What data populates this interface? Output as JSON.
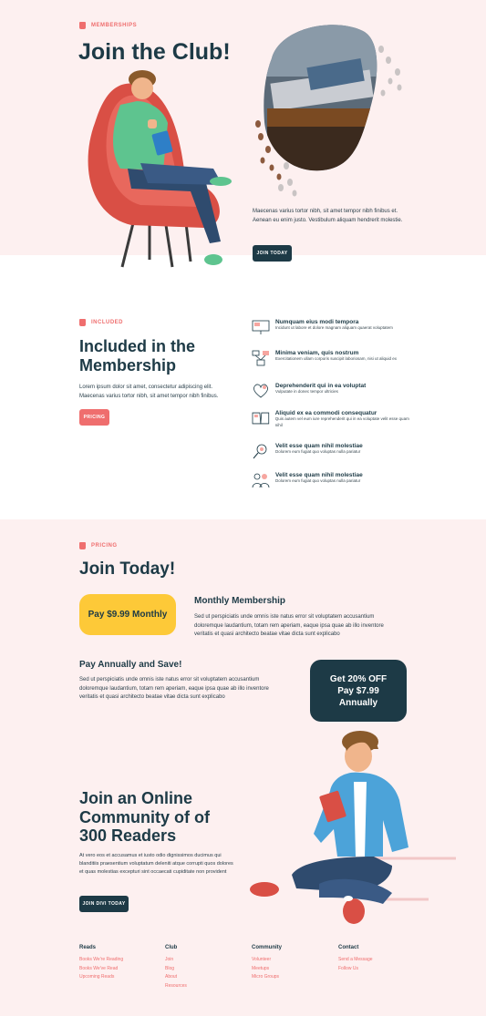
{
  "hero": {
    "eyebrow": "MEMBERSHIPS",
    "title": "Join the Club!",
    "description": "Maecenas varius tortor nibh, sit amet tempor nibh finibus et. Aenean eu enim justo. Vestibulum aliquam hendrerit molestie.",
    "cta": "JOIN TODAY"
  },
  "included": {
    "eyebrow": "INCLUDED",
    "title_line1": "Included in the",
    "title_line2": "Membership",
    "description": "Lorem ipsum dolor sit amet, consectetur adipiscing elit. Maecenas varius tortor nibh, sit amet tempor nibh finibus.",
    "cta": "PRICING",
    "features": [
      {
        "icon": "presentation-icon",
        "title": "Numquam eius modi tempora",
        "desc": "Incidunt ut labore et dolore magnam aliquam quaerat voluptatem"
      },
      {
        "icon": "flowchart-icon",
        "title": "Minima veniam, quis nostrum",
        "desc": "Exercitationem ullam corporis suscipit laboriosam, nisi ut aliquid ex"
      },
      {
        "icon": "heart-icon",
        "title": "Deprehenderit qui in ea voluptat",
        "desc": "Vulputate in donec tempor ultricies"
      },
      {
        "icon": "open-book-icon",
        "title": "Aliquid ex ea commodi consequatur",
        "desc": "Quis autem vel eum iure reprehenderit qui in ea voluptate velit esse quam nihil"
      },
      {
        "icon": "search-person-icon",
        "title": "Velit esse quam nihil molestiae",
        "desc": "Dolorem eum fugiat quo voluptas nulla pariatur"
      },
      {
        "icon": "group-icon",
        "title": "Velit esse quam nihil molestiae",
        "desc": "Dolorem eum fugiat quo voluptas nulla pariatur"
      }
    ]
  },
  "pricing": {
    "eyebrow": "PRICING",
    "title": "Join Today!",
    "monthly_price": "Pay $9.99 Monthly",
    "monthly_title": "Monthly Membership",
    "monthly_desc": "Sed ut perspiciatis unde omnis iste natus error sit voluptatem accusantium doloremque laudantium, totam rem aperiam, eaque ipsa quae ab illo inventore veritatis et quasi architecto beatae vitae dicta sunt explicabo",
    "annual_title": "Pay Annually and Save!",
    "annual_desc": "Sed ut perspiciatis unde omnis iste natus error sit voluptatem accusantium doloremque laudantium, totam rem aperiam, eaque ipsa quae ab illo inventore veritatis et quasi architecto beatae vitae dicta sunt explicabo",
    "annual_price_line1": "Get 20% OFF",
    "annual_price_line2": "Pay $7.99",
    "annual_price_line3": "Annually"
  },
  "community": {
    "title_line1": "Join an Online",
    "title_line2": "Community of of",
    "title_line3": "300 Readers",
    "description": "At vero eos et accusamus et iusto odio dignissimos ducimus qui blanditiis praesentium voluptatum deleniti atque corrupti quos dolores et quas molestias excepturi sint occaecati cupiditate non provident",
    "cta": "JOIN DIVI TODAY"
  },
  "footer": {
    "columns": [
      {
        "heading": "Reads",
        "links": [
          "Books We're Reading",
          "Books We've Read",
          "Upcoming Reads"
        ]
      },
      {
        "heading": "Club",
        "links": [
          "Join",
          "Blog",
          "About",
          "Resources"
        ]
      },
      {
        "heading": "Community",
        "links": [
          "Volunteer",
          "Meetups",
          "Micro Groups"
        ]
      },
      {
        "heading": "Contact",
        "links": [
          "Send a Message",
          "Follow Us"
        ]
      }
    ]
  },
  "colors": {
    "accent": "#ef6e6e",
    "dark": "#1d3a46",
    "yellow": "#fdc938",
    "background_pink": "#fdf0f0"
  }
}
